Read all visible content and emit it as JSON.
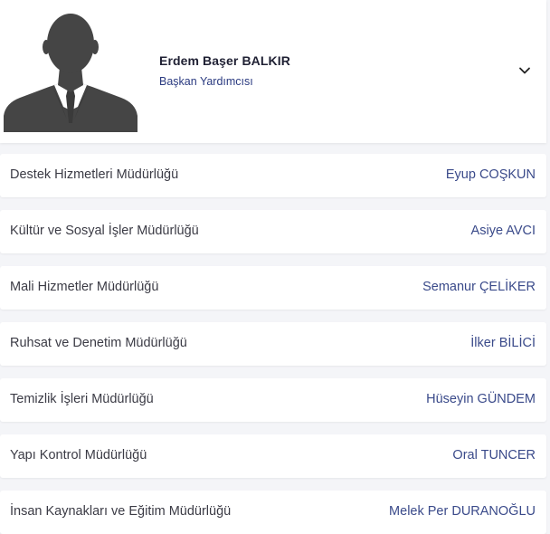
{
  "header": {
    "name": "Erdem Başer BALKIR",
    "title": "Başkan Yardımcısı",
    "avatar_icon": "person-silhouette-icon",
    "expand_icon": "chevron-down-icon"
  },
  "departments": [
    {
      "name": "Destek Hizmetleri Müdürlüğü",
      "manager": "Eyup COŞKUN"
    },
    {
      "name": "Kültür ve Sosyal İşler Müdürlüğü",
      "manager": "Asiye AVCI"
    },
    {
      "name": "Mali Hizmetler Müdürlüğü",
      "manager": "Semanur ÇELİKER"
    },
    {
      "name": "Ruhsat ve Denetim Müdürlüğü",
      "manager": "İlker BİLİCİ"
    },
    {
      "name": "Temizlik İşleri Müdürlüğü",
      "manager": "Hüseyin GÜNDEM"
    },
    {
      "name": "Yapı Kontrol Müdürlüğü",
      "manager": "Oral TUNCER"
    },
    {
      "name": "İnsan Kaynakları ve Eğitim Müdürlüğü",
      "manager": "Melek Per DURANOĞLU"
    }
  ],
  "colors": {
    "background": "#f4f5f8",
    "card": "#ffffff",
    "accent": "#2a3a80",
    "silhouette": "#454545"
  }
}
